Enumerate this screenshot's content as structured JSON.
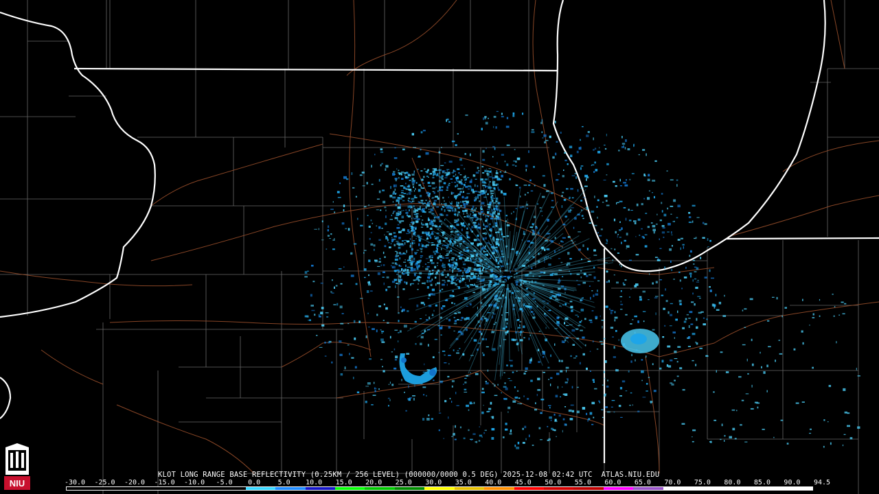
{
  "product": {
    "caption": "KLOT LONG RANGE BASE REFLECTIVITY (0.25KM / 256 LEVEL) (000000/0000 0.5 DEG) 2025-12-08 02:42 UTC  ATLAS.NIU.EDU"
  },
  "scale": {
    "labels": [
      "-30.0",
      "-25.0",
      "-20.0",
      "-15.0",
      "-10.0",
      "-5.0",
      "0.0",
      "5.0",
      "10.0",
      "15.0",
      "20.0",
      "25.0",
      "30.0",
      "35.0",
      "40.0",
      "45.0",
      "50.0",
      "55.0",
      "60.0",
      "65.0",
      "70.0",
      "75.0",
      "80.0",
      "85.0",
      "90.0",
      "94.5"
    ],
    "colors": [
      "#000000",
      "#000000",
      "#000000",
      "#000000",
      "#000000",
      "#000000",
      "#38d7ff",
      "#1e8bff",
      "#1414c8",
      "#08ff08",
      "#00c800",
      "#008c00",
      "#ffff00",
      "#e6c000",
      "#ff9000",
      "#ff0000",
      "#d40000",
      "#c00000",
      "#ff00ff",
      "#9955c9",
      "#ffffff",
      "#ffffff",
      "#ffffff",
      "#ffffff",
      "#ffffff"
    ]
  },
  "colors": {
    "state_border": "#ffffff",
    "county_line": "#8a8a8a",
    "highway": "#a0522d",
    "echo_light": "#49c8f0",
    "echo_mid": "#1ea5e8",
    "echo_dark": "#1273c9"
  },
  "logo": {
    "text": "NIU",
    "icon": "niu-castle-logo"
  }
}
